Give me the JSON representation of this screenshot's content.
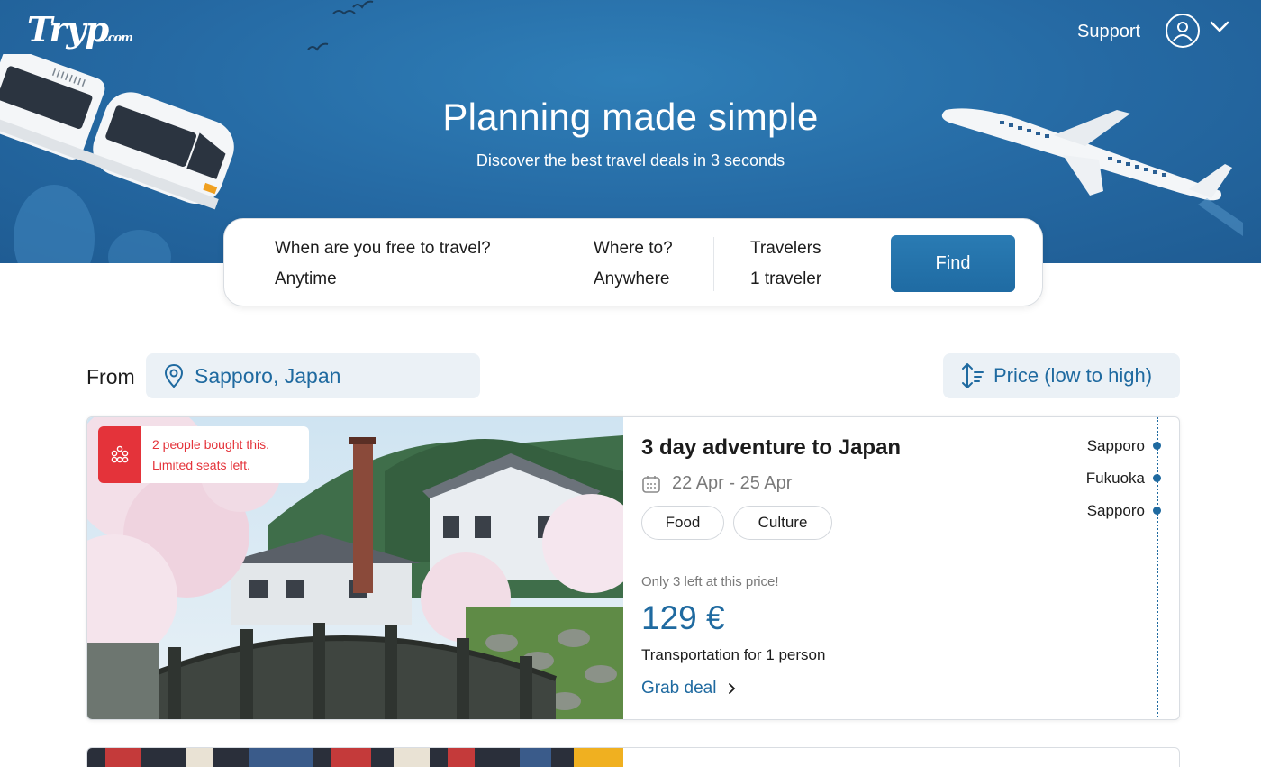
{
  "header": {
    "logo_main": "Tryp",
    "logo_suffix": ".com",
    "support_label": "Support",
    "account_icon": "user-circle-icon",
    "menu_icon": "chevron-down-icon"
  },
  "hero": {
    "title": "Planning made simple",
    "subtitle": "Discover the best travel deals in 3 seconds"
  },
  "search": {
    "when_label": "When are you free to travel?",
    "when_value": "Anytime",
    "where_label": "Where to?",
    "where_value": "Anywhere",
    "travelers_label": "Travelers",
    "travelers_value": "1 traveler",
    "find_label": "Find"
  },
  "filters": {
    "from_label": "From",
    "from_value": "Sapporo, Japan",
    "sort_label": "Price (low to high)"
  },
  "deals": [
    {
      "badge_line1": "2 people bought this.",
      "badge_line2": "Limited seats left.",
      "title": "3 day adventure to Japan",
      "dates": "22 Apr - 25 Apr",
      "tags": [
        "Food",
        "Culture"
      ],
      "availability": "Only 3 left at this price!",
      "price": "129 €",
      "transport": "Transportation for 1 person",
      "cta": "Grab deal",
      "route": [
        "Sapporo",
        "Fukuoka",
        "Sapporo"
      ]
    }
  ],
  "colors": {
    "hero_blue": "#2569a3",
    "accent_blue": "#1f6aa0",
    "alert_red": "#e4333a",
    "chip_bg": "#ebf1f6"
  }
}
